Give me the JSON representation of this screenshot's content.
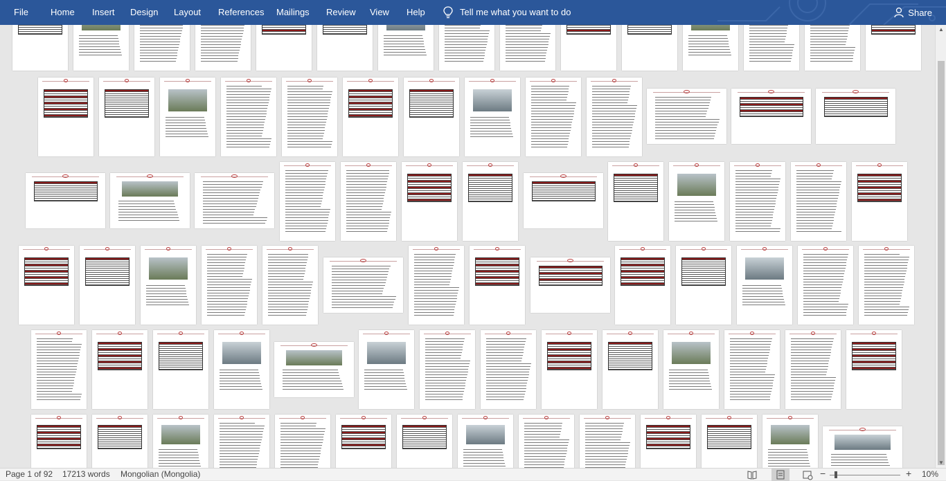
{
  "ribbon": {
    "tabs": [
      "File",
      "Home",
      "Insert",
      "Design",
      "Layout",
      "References",
      "Mailings",
      "Review",
      "View",
      "Help"
    ],
    "tell_me": "Tell me what you want to do",
    "share": "Share",
    "color": "#2b579a"
  },
  "status": {
    "page": "Page 1 of 92",
    "words": "17213 words",
    "language": "Mongolian (Mongolia)",
    "zoom": "10%"
  },
  "icons": [
    "lightbulb-icon",
    "person-icon",
    "read-mode-icon",
    "print-layout-icon",
    "web-layout-icon",
    "zoom-out-icon",
    "zoom-in-icon"
  ],
  "document": {
    "page_count": 92,
    "accent": "#8b1a1a"
  }
}
